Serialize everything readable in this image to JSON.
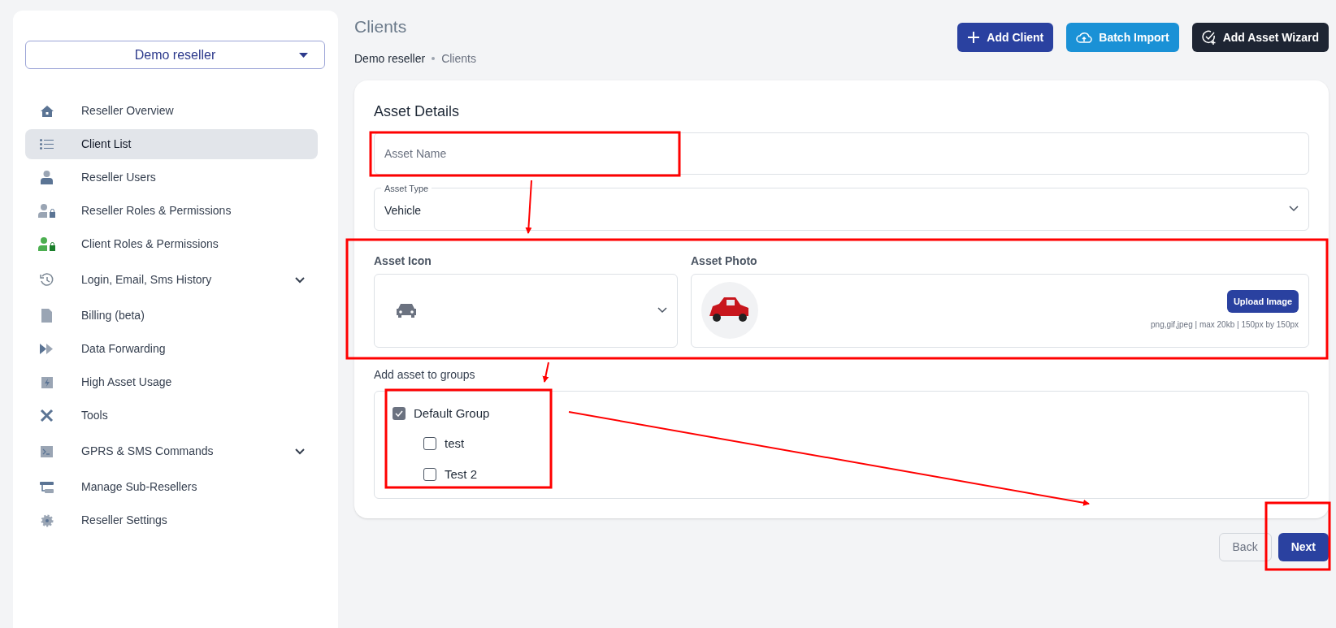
{
  "sidebar": {
    "account_select": "Demo reseller",
    "items": [
      {
        "label": "Reseller Overview",
        "selected": false,
        "expandable": false
      },
      {
        "label": "Client List",
        "selected": true,
        "expandable": false
      },
      {
        "label": "Reseller Users",
        "selected": false,
        "expandable": false
      },
      {
        "label": "Reseller Roles & Permissions",
        "selected": false,
        "expandable": false
      },
      {
        "label": "Client Roles & Permissions",
        "selected": false,
        "expandable": false
      },
      {
        "label": "Login, Email, Sms History",
        "selected": false,
        "expandable": true
      },
      {
        "label": "Billing (beta)",
        "selected": false,
        "expandable": false
      },
      {
        "label": "Data Forwarding",
        "selected": false,
        "expandable": false
      },
      {
        "label": "High Asset Usage",
        "selected": false,
        "expandable": false
      },
      {
        "label": "Tools",
        "selected": false,
        "expandable": false
      },
      {
        "label": "GPRS & SMS Commands",
        "selected": false,
        "expandable": true
      },
      {
        "label": "Manage Sub-Resellers",
        "selected": false,
        "expandable": false
      },
      {
        "label": "Reseller Settings",
        "selected": false,
        "expandable": false
      }
    ]
  },
  "header": {
    "title": "Clients",
    "breadcrumb": [
      "Demo reseller",
      "Clients"
    ],
    "buttons": [
      {
        "label": "Add Client",
        "kind": "plus"
      },
      {
        "label": "Batch Import",
        "kind": "upload"
      },
      {
        "label": "Add Asset Wizard",
        "kind": "wizard"
      }
    ]
  },
  "form": {
    "title": "Asset Details",
    "asset_name": {
      "placeholder": "Asset Name"
    },
    "asset_type": {
      "label": "Asset Type",
      "value": "Vehicle"
    },
    "asset_icon": {
      "label": "Asset Icon"
    },
    "asset_photo": {
      "label": "Asset Photo",
      "button": "Upload Image",
      "hint": "png,gif,jpeg | max 20kb | 150px by 150px"
    },
    "groups": {
      "label": "Add asset to groups",
      "items": [
        {
          "label": "Default Group",
          "checked": true,
          "children": [
            {
              "label": "test",
              "checked": false
            },
            {
              "label": "Test 2",
              "checked": false
            }
          ]
        }
      ]
    }
  },
  "footer_buttons": [
    {
      "label": "Back",
      "kind": "secondary"
    },
    {
      "label": "Next",
      "kind": "primary"
    }
  ]
}
